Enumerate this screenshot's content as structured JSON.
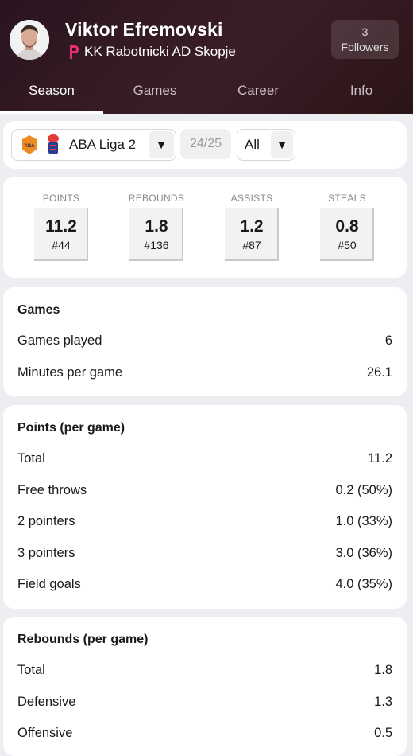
{
  "player": {
    "name": "Viktor Efremovski",
    "team": "KK Rabotnicki AD Skopje"
  },
  "followers": {
    "count": "3",
    "label": "Followers"
  },
  "tabs": [
    {
      "label": "Season"
    },
    {
      "label": "Games"
    },
    {
      "label": "Career"
    },
    {
      "label": "Info"
    }
  ],
  "filters": {
    "league": "ABA Liga 2",
    "season": "24/25",
    "scope": "All"
  },
  "stats": [
    {
      "label": "POINTS",
      "value": "11.2",
      "rank": "#44"
    },
    {
      "label": "REBOUNDS",
      "value": "1.8",
      "rank": "#136"
    },
    {
      "label": "ASSISTS",
      "value": "1.2",
      "rank": "#87"
    },
    {
      "label": "STEALS",
      "value": "0.8",
      "rank": "#50"
    }
  ],
  "sections": [
    {
      "title": "Games",
      "rows": [
        {
          "label": "Games played",
          "value": "6"
        },
        {
          "label": "Minutes per game",
          "value": "26.1"
        }
      ]
    },
    {
      "title": "Points (per game)",
      "rows": [
        {
          "label": "Total",
          "value": "11.2"
        },
        {
          "label": "Free throws",
          "value": "0.2 (50%)"
        },
        {
          "label": "2 pointers",
          "value": "1.0 (33%)"
        },
        {
          "label": "3 pointers",
          "value": "3.0 (36%)"
        },
        {
          "label": "Field goals",
          "value": "4.0 (35%)"
        }
      ]
    },
    {
      "title": "Rebounds (per game)",
      "rows": [
        {
          "label": "Total",
          "value": "1.8"
        },
        {
          "label": "Defensive",
          "value": "1.3"
        },
        {
          "label": "Offensive",
          "value": "0.5"
        }
      ]
    }
  ]
}
